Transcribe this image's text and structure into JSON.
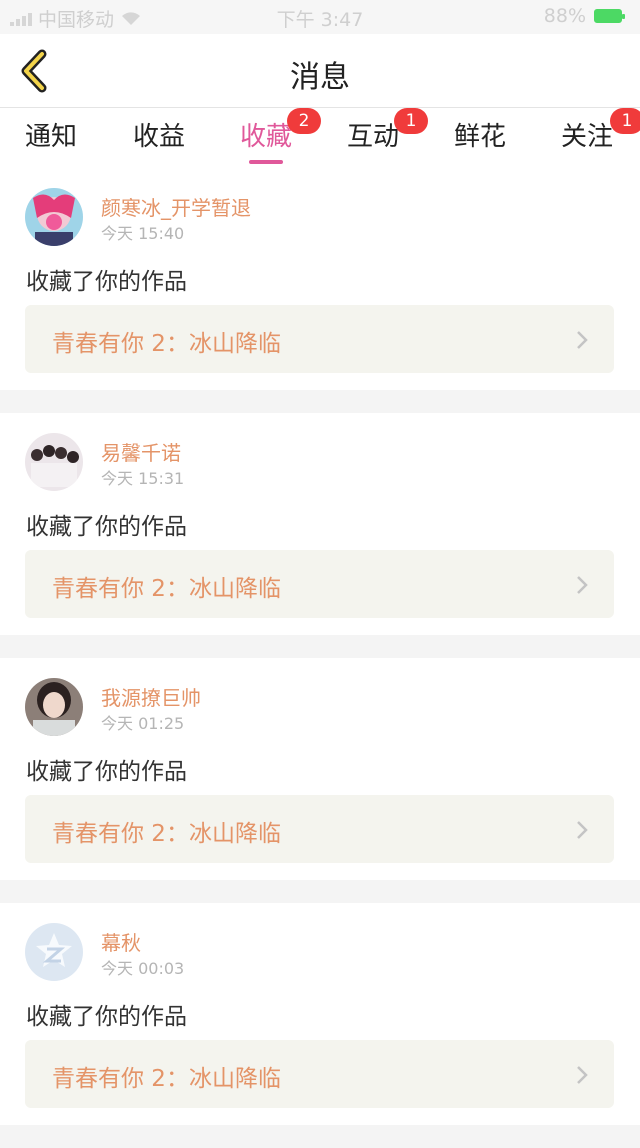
{
  "status_bar": {
    "carrier": "中国移动",
    "time": "下午 3:47",
    "battery": "88%"
  },
  "nav": {
    "title": "消息",
    "back_icon": "chevron-left-icon"
  },
  "tabs": [
    {
      "label": "通知",
      "badge": ""
    },
    {
      "label": "收益",
      "badge": ""
    },
    {
      "label": "收藏",
      "badge": "2",
      "active": true
    },
    {
      "label": "互动",
      "badge": "1"
    },
    {
      "label": "鲜花",
      "badge": ""
    },
    {
      "label": "关注",
      "badge": "1"
    }
  ],
  "messages": [
    {
      "username": "颜寒冰_开学暂退",
      "time": "今天 15:40",
      "action": "收藏了你的作品",
      "work": "青春有你 2：冰山降临",
      "avatar_color": "#e86aa0"
    },
    {
      "username": "易馨千诺",
      "time": "今天 15:31",
      "action": "收藏了你的作品",
      "work": "青春有你 2：冰山降临",
      "avatar_color": "#c9b8c0"
    },
    {
      "username": "我源撩巨帅",
      "time": "今天 01:25",
      "action": "收藏了你的作品",
      "work": "青春有你 2：冰山降临",
      "avatar_color": "#6b5a55"
    },
    {
      "username": "幕秋",
      "time": "今天 00:03",
      "action": "收藏了你的作品",
      "work": "青春有你 2：冰山降临",
      "avatar_color": "#dbe6f1"
    }
  ],
  "colors": {
    "accent": "#e0589a",
    "name": "#e49468",
    "badge": "#f03b3b"
  }
}
